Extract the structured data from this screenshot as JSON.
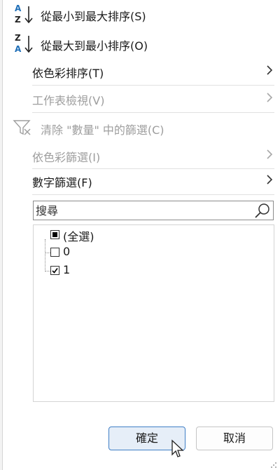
{
  "menu": {
    "sort_asc": {
      "label": "從最小到最大排序(S)",
      "icon": "sort-ascending-icon"
    },
    "sort_desc": {
      "label": "從最大到最小排序(O)",
      "icon": "sort-descending-icon"
    },
    "sort_by_color": {
      "label": "依色彩排序(T)"
    },
    "sheet_view": {
      "label": "工作表檢視(V)"
    },
    "clear_filter": {
      "label": "清除 \"數量\" 中的篩選(C)",
      "icon": "clear-filter-icon"
    },
    "filter_by_color": {
      "label": "依色彩篩選(I)"
    },
    "number_filters": {
      "label": "數字篩選(F)"
    }
  },
  "search": {
    "placeholder": "搜尋",
    "icon": "search-icon"
  },
  "filter_list": {
    "items": [
      {
        "label": "(全選)",
        "state": "partial"
      },
      {
        "label": "0",
        "state": "unchecked"
      },
      {
        "label": "1",
        "state": "checked"
      }
    ]
  },
  "buttons": {
    "ok": "確定",
    "cancel": "取消"
  },
  "colors": {
    "accent": "#1f6fb8",
    "disabled_text": "#9e9e9e",
    "primary_button_border": "#3f7fc6"
  }
}
